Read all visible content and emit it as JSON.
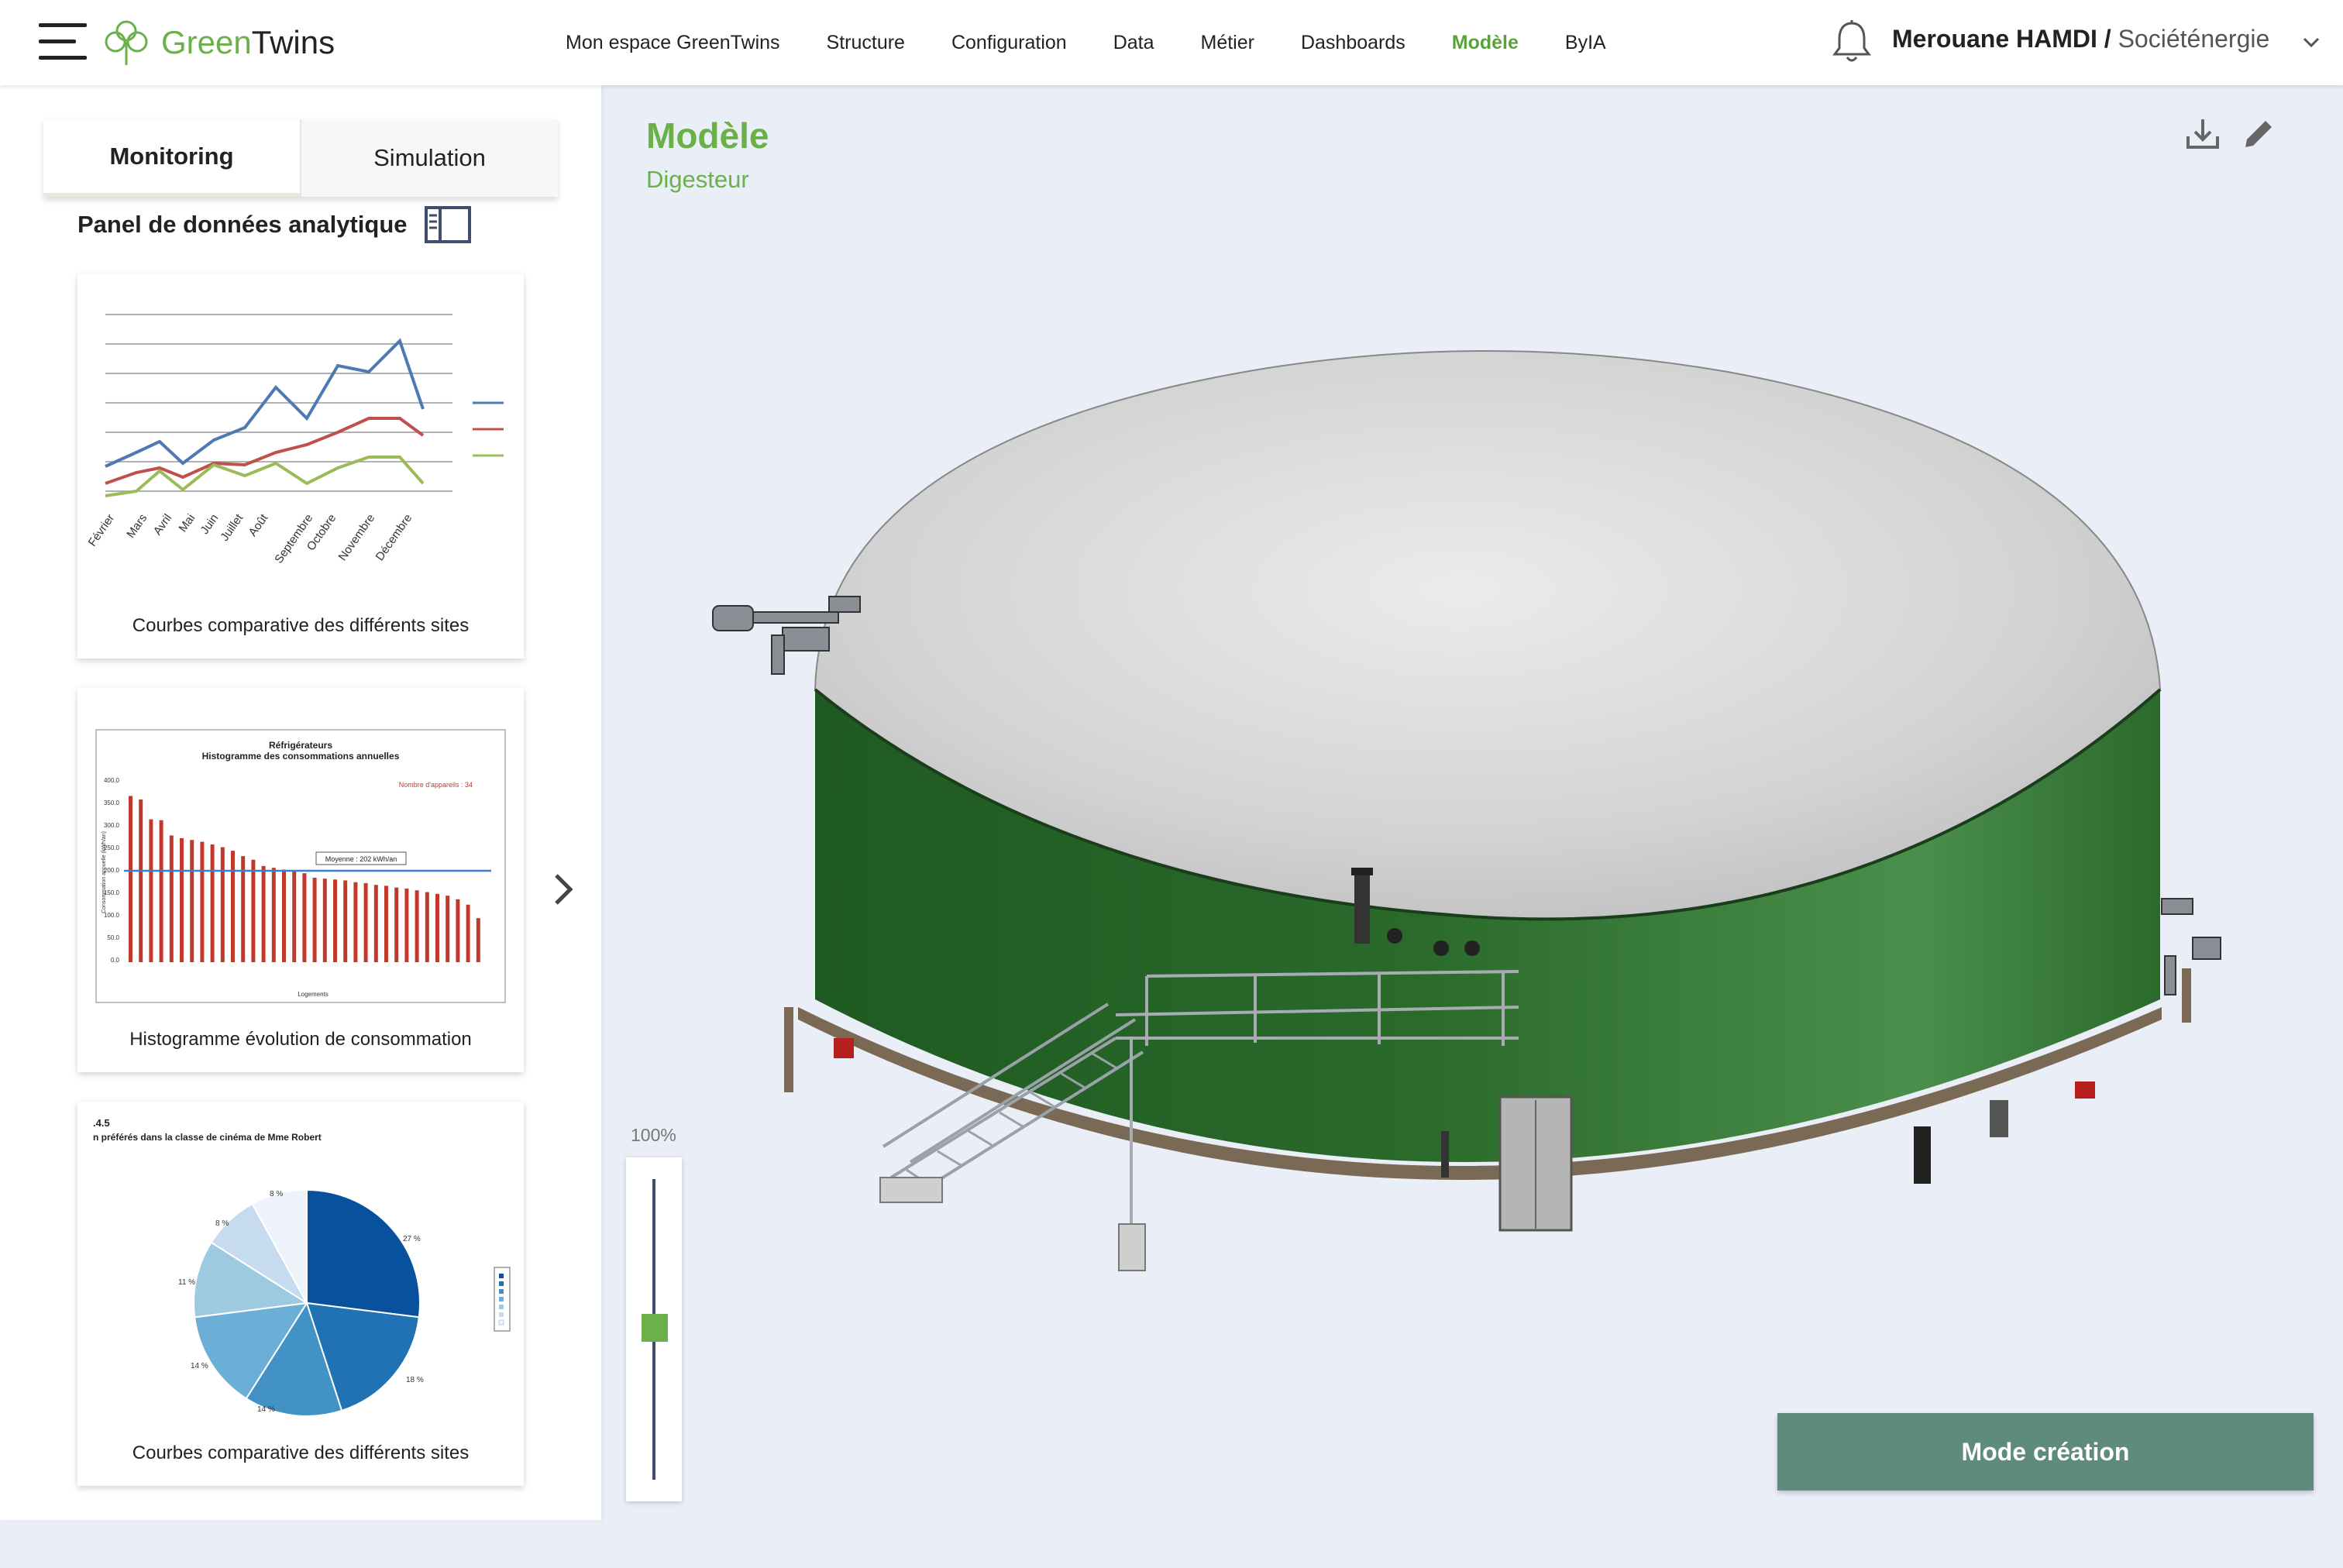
{
  "header": {
    "logo_light": "Green",
    "logo_dark": "Twins",
    "nav": [
      {
        "label": "Mon espace GreenTwins"
      },
      {
        "label": "Structure"
      },
      {
        "label": "Configuration"
      },
      {
        "label": "Data"
      },
      {
        "label": "Métier"
      },
      {
        "label": "Dashboards"
      },
      {
        "label": "Modèle"
      },
      {
        "label": "ByIA"
      }
    ],
    "active_nav": "Modèle",
    "user_name": "Merouane HAMDI /",
    "organisation": "Sociéténergie"
  },
  "left_panel": {
    "tabs": [
      {
        "label": "Monitoring"
      },
      {
        "label": "Simulation"
      }
    ],
    "active_tab": "Monitoring",
    "title": "Panel de données analytique",
    "cards": [
      {
        "caption": "Courbes comparative des différents sites"
      },
      {
        "caption": "Histogramme évolution de consommation"
      },
      {
        "caption": "Courbes comparative des différents sites"
      }
    ],
    "thumb1": {
      "months": [
        "Février",
        "Mars",
        "Avril",
        "Mai",
        "Juin",
        "Juillet",
        "Août",
        "Septembre",
        "Octobre",
        "Novembre",
        "Décembre"
      ]
    },
    "thumb2": {
      "title": "Réfrigérateurs",
      "subtitle": "Histogramme des consommations annuelles",
      "note": "Nombre d'appareils : 34",
      "mean_label": "Moyenne : 202 kWh/an",
      "yticks": [
        "400.0",
        "350.0",
        "300.0",
        "250.0",
        "200.0",
        "150.0",
        "100.0",
        "50.0",
        "0.0"
      ],
      "ylabel": "Consommation annuelle (kWh/an)",
      "xlabel": "Logements"
    },
    "thumb3": {
      "heading": ".4.5",
      "title": "n préférés dans la classe de cinéma de Mme Robert",
      "slice_labels": [
        "27 %",
        "18 %",
        "14 %",
        "14 %",
        "11 %",
        "8 %",
        "8 %"
      ]
    }
  },
  "main": {
    "title": "Modèle",
    "subtitle": "Digesteur",
    "zoom_label": "100%",
    "mode_button": "Mode création"
  },
  "colors": {
    "brand_green": "#6cb04a",
    "tank_green": "#2f6e2c",
    "button": "#5f8a7e"
  }
}
